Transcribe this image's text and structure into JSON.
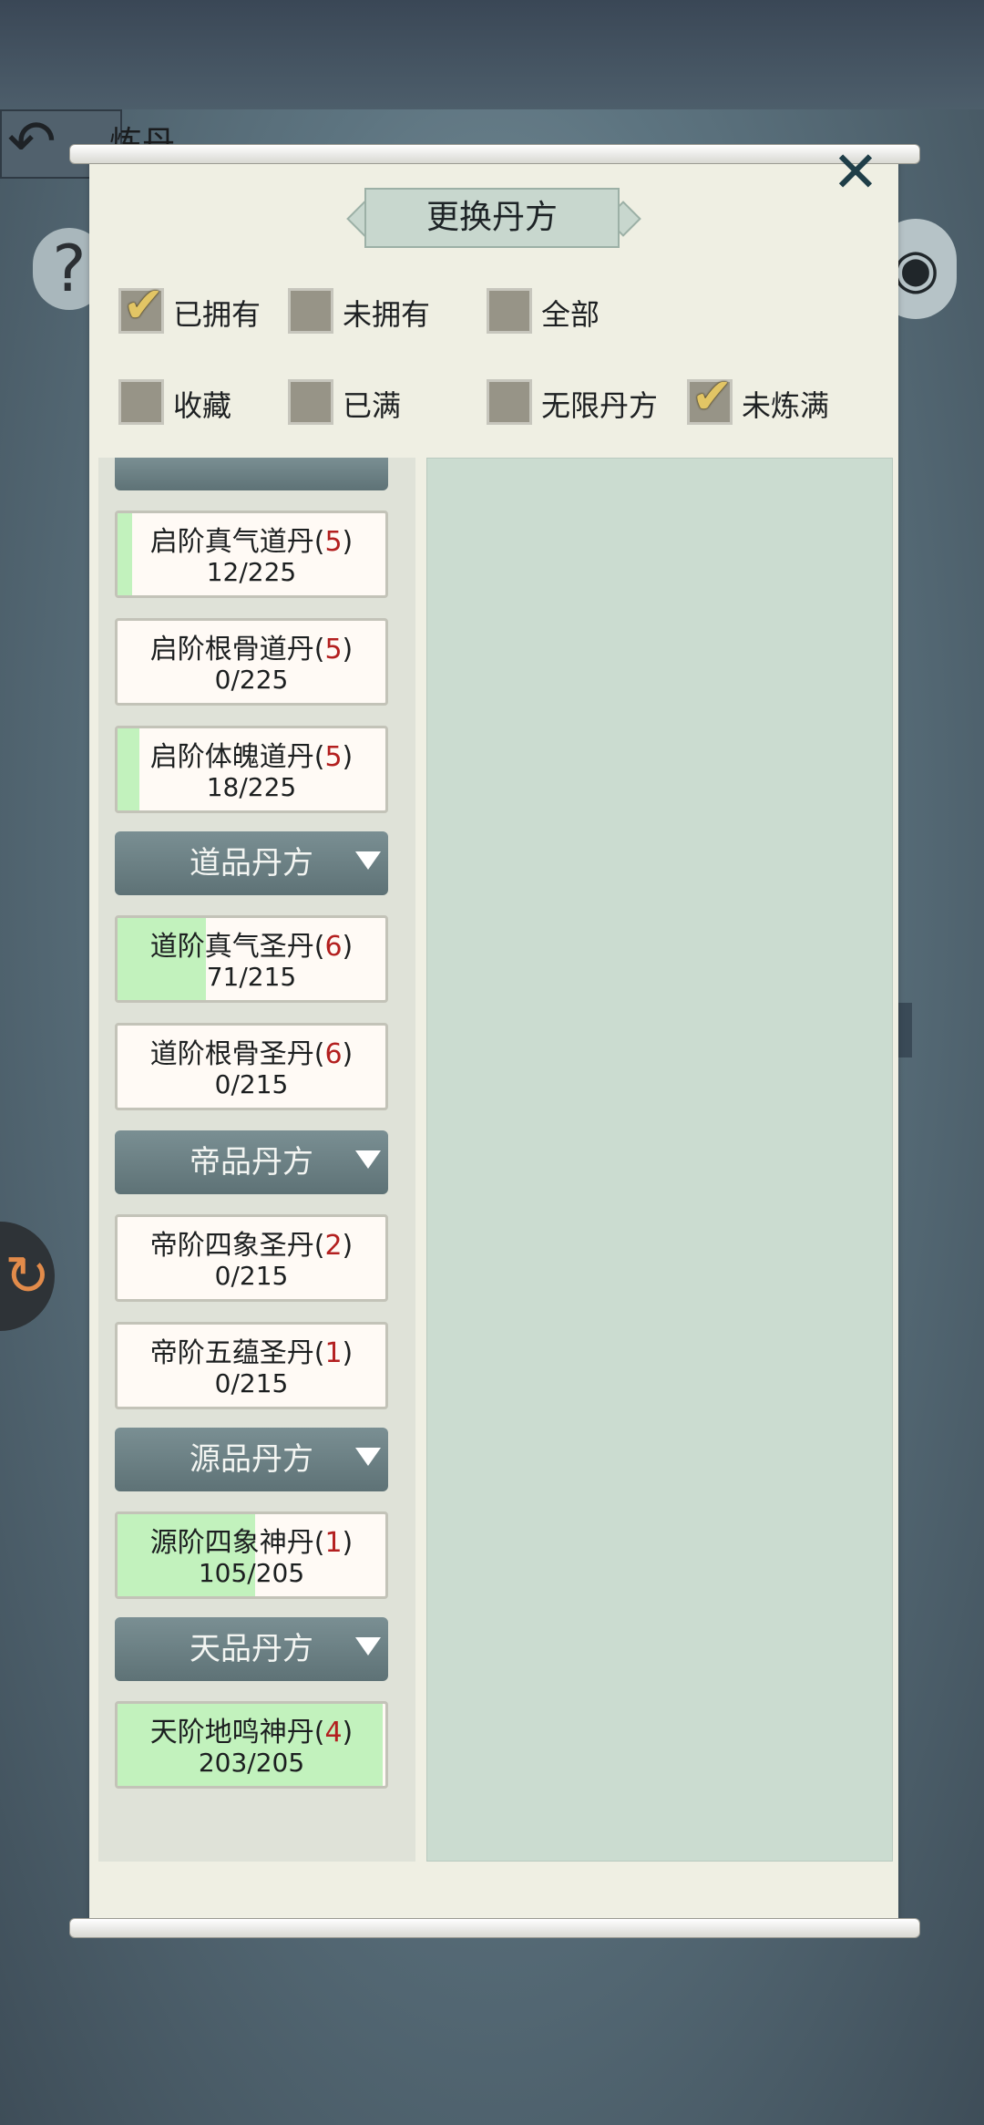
{
  "header": {
    "title": "炼丹"
  },
  "dialog": {
    "title": "更换丹方"
  },
  "filters": [
    {
      "label": "已拥有",
      "checked": true
    },
    {
      "label": "未拥有",
      "checked": false
    },
    {
      "label": "全部",
      "checked": false
    },
    {
      "label": "收藏",
      "checked": false
    },
    {
      "label": "已满",
      "checked": false
    },
    {
      "label": "无限丹方",
      "checked": false
    },
    {
      "label": "未炼满",
      "checked": true
    }
  ],
  "categories": [
    {
      "label": "道品丹方"
    },
    {
      "label": "帝品丹方"
    },
    {
      "label": "源品丹方"
    },
    {
      "label": "天品丹方"
    }
  ],
  "items": [
    {
      "name": "启阶真气道丹",
      "level": "5",
      "count": "12/225",
      "progress": 0.053
    },
    {
      "name": "启阶根骨道丹",
      "level": "5",
      "count": "0/225",
      "progress": 0.0
    },
    {
      "name": "启阶体魄道丹",
      "level": "5",
      "count": "18/225",
      "progress": 0.08
    },
    {
      "name": "道阶真气圣丹",
      "level": "6",
      "count": "71/215",
      "progress": 0.33
    },
    {
      "name": "道阶根骨圣丹",
      "level": "6",
      "count": "0/215",
      "progress": 0.0
    },
    {
      "name": "帝阶四象圣丹",
      "level": "2",
      "count": "0/215",
      "progress": 0.0
    },
    {
      "name": "帝阶五蕴圣丹",
      "level": "1",
      "count": "0/215",
      "progress": 0.0
    },
    {
      "name": "源阶四象神丹",
      "level": "1",
      "count": "105/205",
      "progress": 0.512
    },
    {
      "name": "天阶地鸣神丹",
      "level": "4",
      "count": "203/205",
      "progress": 0.99
    }
  ],
  "icons": {
    "back": "arrow-back-icon",
    "close": "close-icon",
    "help": "help-icon",
    "eye": "eye-icon",
    "check": "checkmark-icon",
    "dropdown": "triangle-down-icon"
  }
}
